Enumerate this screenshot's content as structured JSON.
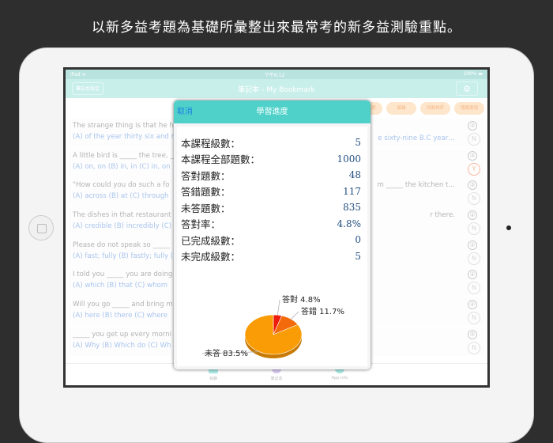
{
  "headline": "以新多益考題為基礎所彙整出來最常考的新多益測驗重點。",
  "status": {
    "device": "iPad ᯤ",
    "time": "下午6:12",
    "battery": "100% ▬"
  },
  "nav": {
    "left_button": "筆記本設定",
    "title": "筆記本 - My Bookmark",
    "settings_icon": "⚙"
  },
  "toolbar": [
    "學習進度",
    "編輯",
    "時間排序",
    "隱藏選項"
  ],
  "rows": [
    {
      "q": "The strange thing is that he h",
      "qr": "",
      "a": "(A) of the year thirty six and n",
      "ar": "e sixty-nine B.C year…",
      "level": "3",
      "mark": "N"
    },
    {
      "q": "A little bird is _____ the tree, _",
      "qr": "",
      "a": "(A) on, on  (B) in, in  (C) in, on",
      "ar": "",
      "level": "3",
      "mark": "Y"
    },
    {
      "q": "\"How could you do such a fo",
      "qr": "m _____ the kitchen t…",
      "a": "(A) across  (B) at  (C) through",
      "ar": "",
      "level": "3",
      "mark": "N"
    },
    {
      "q": "The dishes in that restaurant",
      "qr": "r there.",
      "a": "(A) credible  (B) incredibly  (C)",
      "ar": "",
      "level": "2",
      "mark": "N"
    },
    {
      "q": "Please do not speak so _____",
      "qr": "",
      "a": "(A) fast; fully  (B) fastly; fully  (",
      "ar": "",
      "level": "2",
      "mark": "N"
    },
    {
      "q": "I told you _____ you are doing",
      "qr": "",
      "a": "(A) which  (B) that  (C) whom",
      "ar": "",
      "level": "2",
      "mark": "N"
    },
    {
      "q": "Will you go _____ and bring m",
      "qr": "",
      "a": "(A) here  (B) there  (C) where",
      "ar": "",
      "level": "2",
      "mark": "N"
    },
    {
      "q": "_____ you get up every morni",
      "qr": "",
      "a": "(A) Why  (B) Which do  (C) Wh",
      "ar": "",
      "level": "5",
      "mark": "N"
    }
  ],
  "tabs": [
    {
      "label": "目錄",
      "color": "#a8e8e4"
    },
    {
      "label": "筆記本",
      "color": "#d9c8f0"
    },
    {
      "label": "App info",
      "color": "#a8e8e4"
    }
  ],
  "modal": {
    "cancel": "取消",
    "title": "學習進度",
    "stats": [
      {
        "label": "本課程級數：",
        "value": "5"
      },
      {
        "label": "本課程全部題數：",
        "value": "1000"
      },
      {
        "label": "答對題數：",
        "value": "48"
      },
      {
        "label": "答錯題數：",
        "value": "117"
      },
      {
        "label": "未答題數：",
        "value": "835"
      },
      {
        "label": "答對率：",
        "value": "4.8%"
      },
      {
        "label": "已完成級數：",
        "value": "0"
      },
      {
        "label": "未完成級數：",
        "value": "5"
      }
    ]
  },
  "chart_data": {
    "type": "pie",
    "categories": [
      "答對",
      "答錯",
      "未答"
    ],
    "values": [
      4.8,
      11.7,
      83.5
    ],
    "labels": [
      "答對 4.8%",
      "答錯 11.7%",
      "未答 83.5%"
    ],
    "colors": [
      "#ee1c0c",
      "#f26a0a",
      "#f99c05"
    ]
  }
}
